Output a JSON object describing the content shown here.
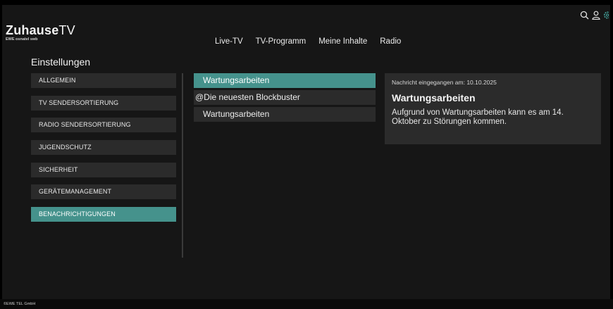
{
  "logo": {
    "brand": "Zuhause",
    "tv": "TV",
    "sub": "EWE osnatel swb"
  },
  "nav": [
    {
      "label": "Live-TV"
    },
    {
      "label": "TV-Programm"
    },
    {
      "label": "Meine Inhalte"
    },
    {
      "label": "Radio"
    }
  ],
  "page_title": "Einstellungen",
  "sidebar": {
    "items": [
      {
        "label": "ALLGEMEIN"
      },
      {
        "label": "TV SENDERSORTIERUNG"
      },
      {
        "label": "RADIO SENDERSORTIERUNG"
      },
      {
        "label": "JUGENDSCHUTZ"
      },
      {
        "label": "SICHERHEIT"
      },
      {
        "label": "GERÄTEMANAGEMENT"
      },
      {
        "label": "BENACHRICHTIGUNGEN"
      }
    ],
    "active_index": 6
  },
  "messages": [
    {
      "label": "Wartungsarbeiten"
    },
    {
      "label": "@Die neuesten Blockbuster"
    },
    {
      "label": "Wartungsarbeiten"
    }
  ],
  "detail": {
    "meta": "Nachricht eingegangen am: 10.10.2025",
    "title": "Wartungsarbeiten",
    "body": "Aufgrund von Wartungsarbeiten kann es am 14. Oktober zu Störungen kommen."
  },
  "footer": {
    "copyright": "©EWE TEL GmbH"
  },
  "colors": {
    "accent": "#45928c",
    "background": "#161616",
    "panel": "#2b2b2b"
  },
  "icons": [
    "search-icon",
    "user-icon",
    "gear-icon"
  ]
}
